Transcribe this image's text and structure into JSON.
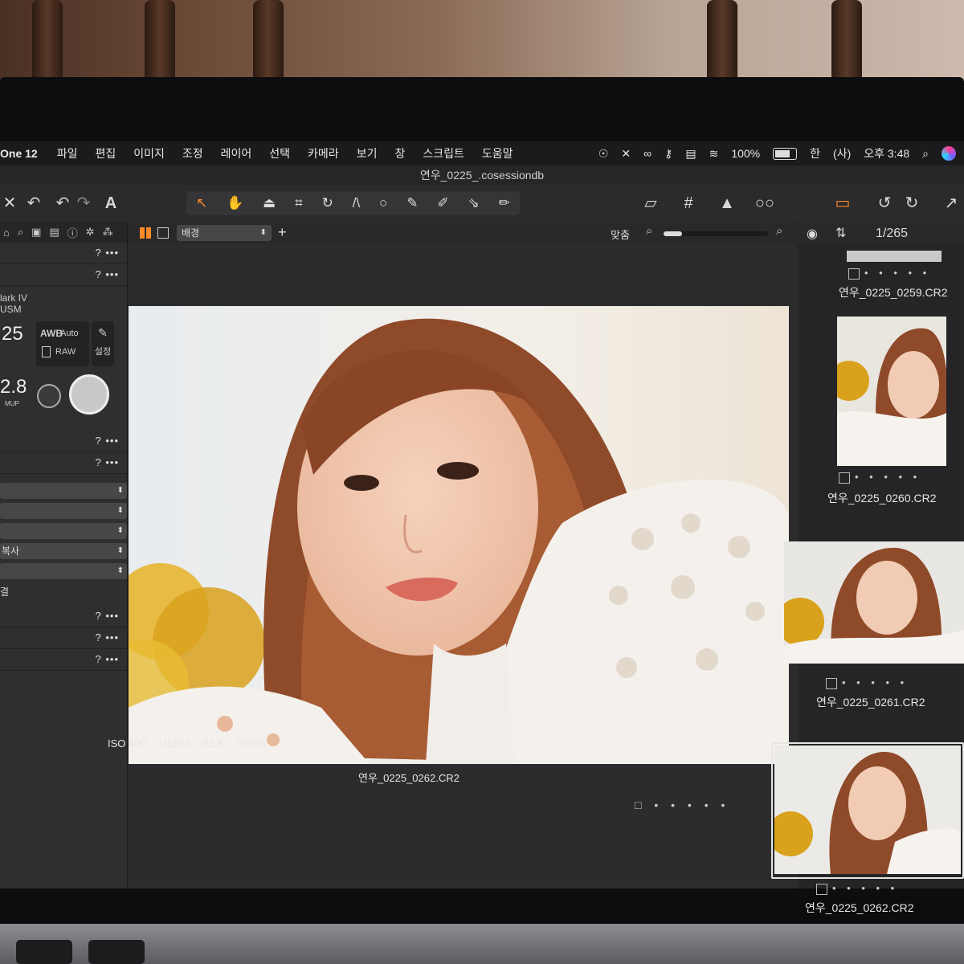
{
  "menubar": {
    "app": "One 12",
    "items": [
      "파일",
      "편집",
      "이미지",
      "조정",
      "레이어",
      "선택",
      "카메라",
      "보기",
      "창",
      "스크립트",
      "도움말"
    ],
    "battery": "100%",
    "input_method": "한",
    "volume_user": "(사)",
    "clock": "오후 3:48"
  },
  "window": {
    "title": "연우_0225_.cosessiondb"
  },
  "toolbar": {
    "text_tool": "A",
    "cursor_tool": "↖",
    "pan_tool": "✋",
    "crop_tool": "⌗",
    "rotate_tool": "↻",
    "circle_tool": "○",
    "brush_tool": "✎"
  },
  "left_panel": {
    "help_label": "? •••",
    "camera_model_line1": "lark IV",
    "camera_model_line2": "USM",
    "shutter_value": "25",
    "aperture_value": "2.8",
    "wb_mode": "AWB",
    "wb_value": "Auto",
    "format": "RAW",
    "settings_label": "설정",
    "mup_label": "MUP",
    "select_copy": "복사",
    "select_last": "결"
  },
  "viewer": {
    "mode_select": "배경",
    "fit_label": "맞춤",
    "zoom_level": 0.18,
    "iso": "ISO 400",
    "shutter": "1/125 s",
    "aperture": "f/2.8",
    "focal_length": "70 mm",
    "filename": "연우_0225_0262.CR2",
    "rating_dots": "□ • • • • •"
  },
  "browser": {
    "count": "1/265",
    "rating_dots": "• • • • •",
    "thumbnails": [
      {
        "filename": "연우_0225_0259.CR2"
      },
      {
        "filename": "연우_0225_0260.CR2"
      },
      {
        "filename": "연우_0225_0261.CR2"
      },
      {
        "filename": "연우_0225_0262.CR2"
      }
    ]
  },
  "colors": {
    "accent": "#ff8a2b",
    "panel": "#2f2f31",
    "menubar": "#1b1b1d"
  }
}
